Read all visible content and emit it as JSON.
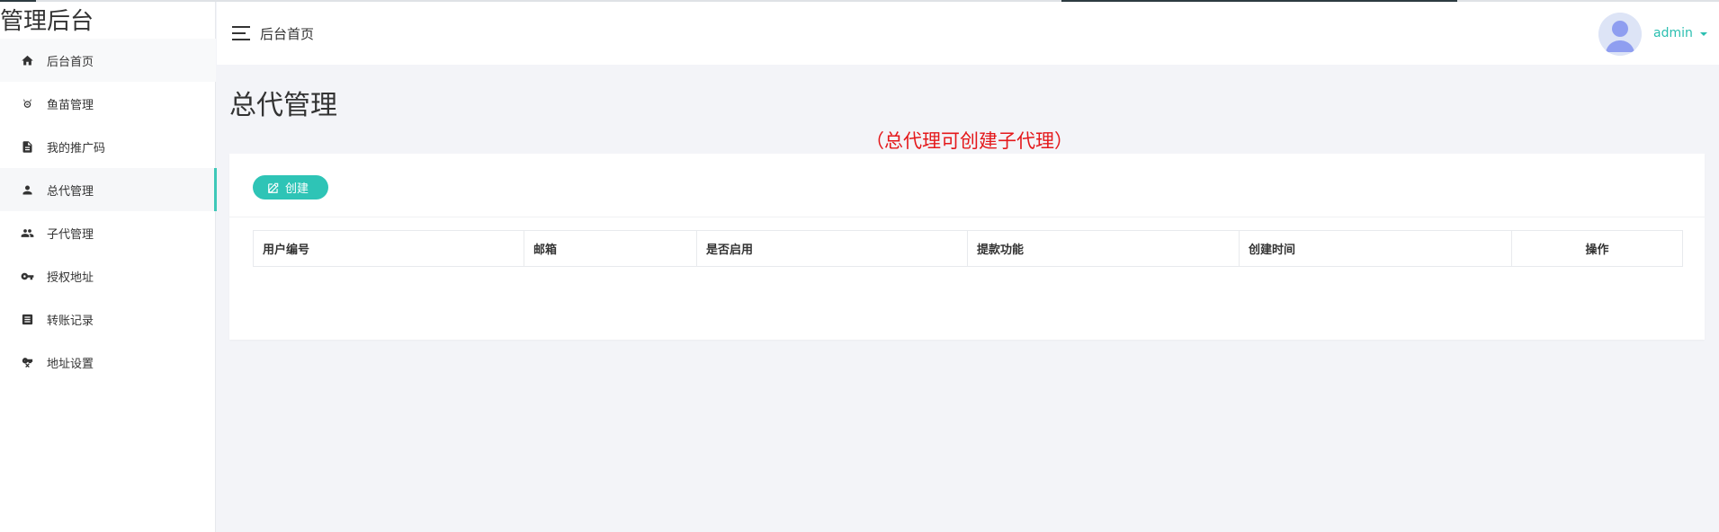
{
  "brand": {
    "title": "管理后台"
  },
  "sidebar": {
    "items": [
      {
        "label": "后台首页",
        "icon": "home-icon"
      },
      {
        "label": "鱼苗管理",
        "icon": "fish-icon"
      },
      {
        "label": "我的推广码",
        "icon": "document-icon"
      },
      {
        "label": "总代管理",
        "icon": "user-icon",
        "active": true
      },
      {
        "label": "子代管理",
        "icon": "users-icon"
      },
      {
        "label": "授权地址",
        "icon": "key-icon"
      },
      {
        "label": "转账记录",
        "icon": "list-icon"
      },
      {
        "label": "地址设置",
        "icon": "key-settings-icon"
      }
    ]
  },
  "header": {
    "breadcrumb": "后台首页",
    "user_name": "admin"
  },
  "main": {
    "page_title": "总代管理",
    "hint": "（总代理可创建子代理）",
    "create_label": "创建",
    "table": {
      "columns": [
        "用户编号",
        "邮箱",
        "是否启用",
        "提款功能",
        "创建时间",
        "操作"
      ],
      "rows": []
    }
  },
  "colors": {
    "accent": "#2ec4b6",
    "hint": "#e4181b",
    "background": "#f3f4f8"
  }
}
